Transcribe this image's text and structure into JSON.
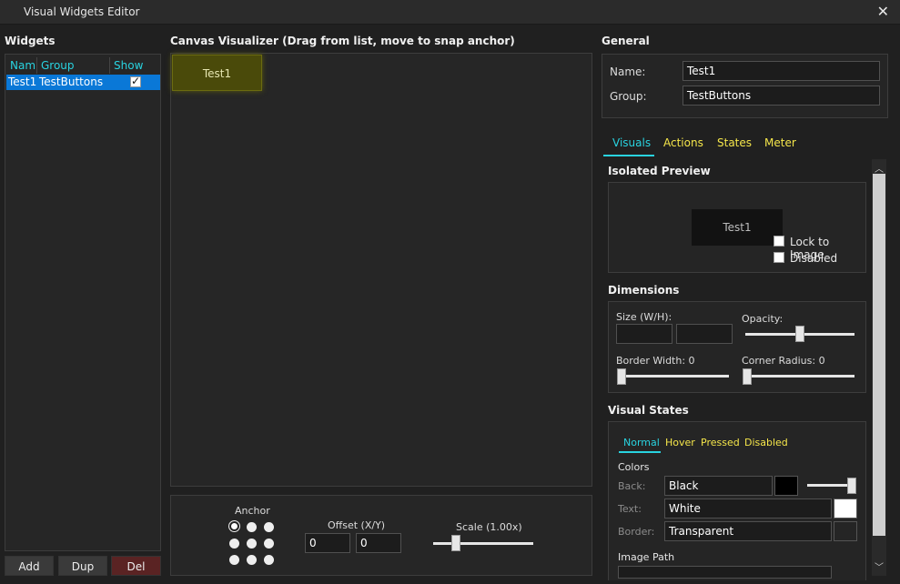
{
  "window": {
    "title": "Visual Widgets Editor"
  },
  "widgets": {
    "header": "Widgets",
    "columns": [
      "Nam",
      "Group",
      "Show"
    ],
    "rows": [
      {
        "name": "Test1",
        "group": "TestButtons",
        "show": true
      }
    ],
    "buttons": {
      "add": "Add",
      "dup": "Dup",
      "del": "Del"
    }
  },
  "canvas": {
    "header": "Canvas Visualizer (Drag from list, move to snap anchor)",
    "widget_label": "Test1",
    "anchor_label": "Anchor",
    "offset_label": "Offset (X/Y)",
    "offset_x": "0",
    "offset_y": "0",
    "scale_label": "Scale (1.00x)",
    "scale_value": 1.0
  },
  "general": {
    "header": "General",
    "name_label": "Name:",
    "name_value": "Test1",
    "group_label": "Group:",
    "group_value": "TestButtons"
  },
  "tabs": [
    {
      "label": "Visuals",
      "active": true
    },
    {
      "label": "Actions",
      "active": false
    },
    {
      "label": "States",
      "active": false
    },
    {
      "label": "Meter",
      "active": false
    }
  ],
  "preview": {
    "header": "Isolated Preview",
    "widget_label": "Test1",
    "lock_label": "Lock to Image",
    "disabled_label": "Disabled"
  },
  "dimensions": {
    "header": "Dimensions",
    "size_label": "Size (W/H):",
    "size_w": "",
    "size_h": "",
    "opacity_label": "Opacity:",
    "opacity_value": 0.5,
    "border_label": "Border Width: 0",
    "corner_label": "Corner Radius: 0"
  },
  "visual_states": {
    "header": "Visual States",
    "tabs": [
      {
        "label": "Normal",
        "active": true
      },
      {
        "label": "Hover",
        "active": false
      },
      {
        "label": "Pressed",
        "active": false
      },
      {
        "label": "Disabled",
        "active": false
      }
    ],
    "colors_label": "Colors",
    "back_label": "Back:",
    "back_value": "Black",
    "back_color": "#000000",
    "text_label": "Text:",
    "text_value": "White",
    "text_color": "#ffffff",
    "border_label": "Border:",
    "border_value": "Transparent",
    "border_color": "#252525",
    "image_path_label": "Image Path"
  },
  "colors": {
    "accent": "#29d3e0",
    "tab_inactive": "#f5e64a",
    "selection": "#0a78d7"
  }
}
